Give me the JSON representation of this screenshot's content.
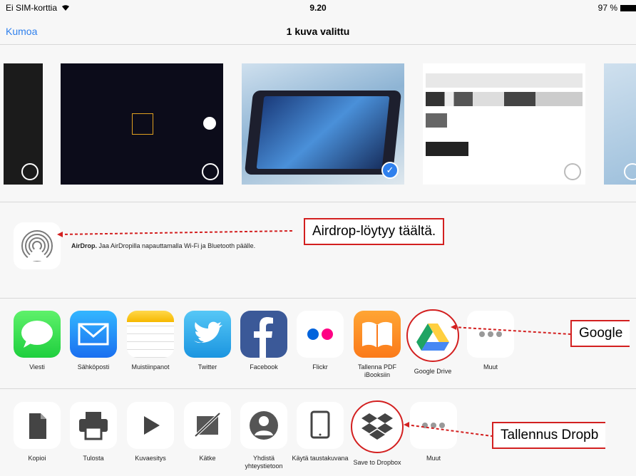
{
  "status_bar": {
    "carrier": "Ei SIM-korttia",
    "wifi_icon": "wifi-icon",
    "time": "9.20",
    "battery": "97 %"
  },
  "nav": {
    "cancel_label": "Kumoa",
    "title": "1 kuva valittu"
  },
  "airdrop": {
    "bold": "AirDrop.",
    "text": "Jaa AirDropilla napauttamalla Wi-Fi ja Bluetooth päälle.",
    "callout": "Airdrop-löytyy täältä."
  },
  "share_apps": [
    {
      "label": "Viesti",
      "icon": "messages-icon"
    },
    {
      "label": "Sähköposti",
      "icon": "mail-icon"
    },
    {
      "label": "Muistiinpanot",
      "icon": "notes-icon"
    },
    {
      "label": "Twitter",
      "icon": "twitter-icon"
    },
    {
      "label": "Facebook",
      "icon": "facebook-icon"
    },
    {
      "label": "Flickr",
      "icon": "flickr-icon"
    },
    {
      "label": "Tallenna PDF iBooksiin",
      "icon": "ibooks-icon"
    },
    {
      "label": "Google Drive",
      "icon": "google-drive-icon"
    },
    {
      "label": "Muut",
      "icon": "more-icon"
    }
  ],
  "share_callout": "Google",
  "actions": [
    {
      "label": "Kopioi",
      "icon": "copy-icon"
    },
    {
      "label": "Tulosta",
      "icon": "print-icon"
    },
    {
      "label": "Kuvaesitys",
      "icon": "play-icon"
    },
    {
      "label": "Kätke",
      "icon": "hide-icon"
    },
    {
      "label": "Yhdistä yhteystietoon",
      "icon": "contact-icon"
    },
    {
      "label": "Käytä taustakuvana",
      "icon": "wallpaper-icon"
    },
    {
      "label": "Save to Dropbox",
      "icon": "dropbox-icon"
    },
    {
      "label": "Muut",
      "icon": "more-icon"
    }
  ],
  "actions_callout": "Tallennus Dropb",
  "colors": {
    "accent": "#2f80ed",
    "callout_red": "#d32020"
  }
}
